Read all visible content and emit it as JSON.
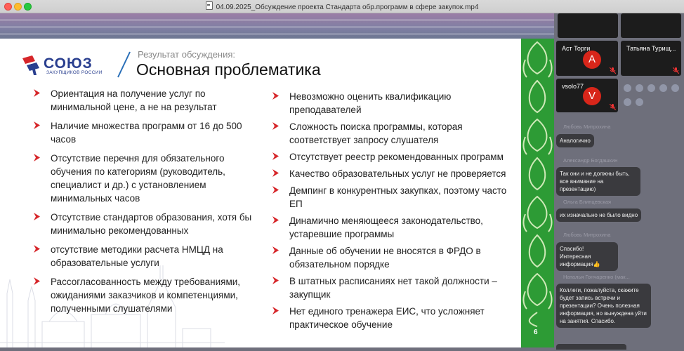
{
  "window": {
    "title": "04.09.2025_Обсуждение проекта Стандарта обр.программ в сфере закупок.mp4"
  },
  "slide": {
    "logo_text": "СОЮЗ",
    "logo_sub": "ЗАКУПЩИКОВ РОССИИ",
    "subtitle": "Результат обсуждения:",
    "heading": "Основная проблематика",
    "page_number": "6",
    "left_items": [
      "Ориентация на получение услуг по минимальной цене, а не на результат",
      "Наличие множества программ от 16 до 500 часов",
      "Отсутствие перечня для обязательного обучения по категориям (руководитель, специалист и др.) с установлением минимальных часов",
      "Отсутствие стандартов образования, хотя бы минимально рекомендованных",
      "отсутствие методики расчета НМЦД на образовательные услуги",
      "Рассогласованность между требованиями, ожиданиями заказчиков и компетенциями, полученными слушателями"
    ],
    "right_items": [
      "Невозможно оценить квалификацию преподавателей",
      "Сложность поиска программы, которая соответствует запросу слушателя",
      "Отсутствует реестр рекомендованных программ",
      "Качество образовательных услуг не проверяется",
      "Демпинг в конкурентных закупках, поэтому часто ЕП",
      "Динамично меняющееся законодательство, устаревшие программы",
      "Данные об обучении не вносятся в ФРДО в обязательном порядке",
      "В штатных расписаниях нет такой должности – закупщик",
      "Нет единого тренажера ЕИС, что усложняет практическое обучение"
    ]
  },
  "participants": [
    {
      "name": "Аст Торги",
      "initial": "A"
    },
    {
      "name": "Татьяна Турищ...",
      "initial": ""
    },
    {
      "name": "vsolo77",
      "initial": "V"
    }
  ],
  "chat": [
    {
      "sender": "Любовь Митрохина",
      "text": "Аналогично"
    },
    {
      "sender": "Александр Богдашкин",
      "text": "Так они и не должны быть, все внимание на презентацию)"
    },
    {
      "sender": "Ольга Блинцевская",
      "text": "их изначально не было видно"
    },
    {
      "sender": "Любовь Митрохина",
      "text": "Спасибо! Интересная информация👍"
    },
    {
      "sender": "Наталья Гончаренко (мак...",
      "text": "Коллеги, пожалуйста, скажите будет запись встречи и презентации? Очень полезная информация, но вынуждена уйти на занятия. Спасибо."
    }
  ],
  "colors": {
    "ornament_green": "#2d9b35",
    "bullet_red": "#d6262a",
    "logo_blue": "#2a3f8f",
    "avatar_red": "#d8261a"
  }
}
